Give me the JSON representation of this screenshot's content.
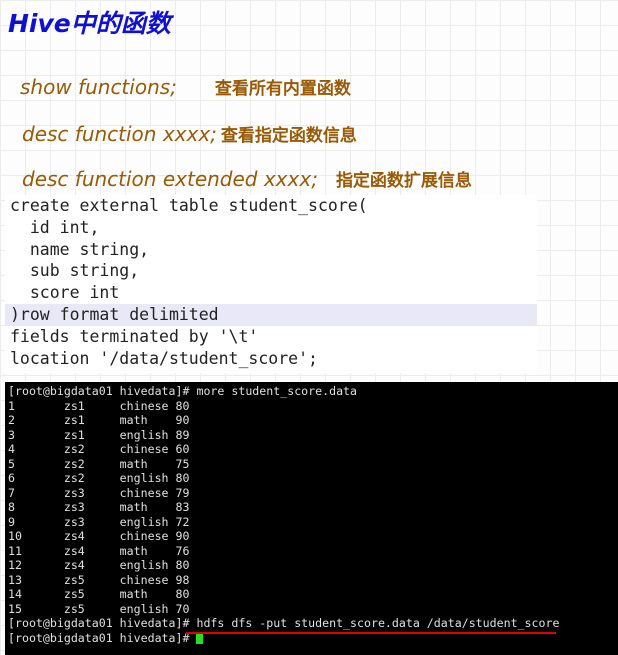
{
  "title": "Hive中的函数",
  "notes": [
    {
      "cmd": "show functions;",
      "desc": "查看所有内置函数"
    },
    {
      "cmd": "desc function xxxx;",
      "desc": "查看指定函数信息"
    },
    {
      "cmd": "desc function extended xxxx;",
      "desc": "指定函数扩展信息"
    }
  ],
  "code": [
    "create external table student_score(",
    "  id int,",
    "  name string,",
    "  sub string,",
    "  score int",
    ")row format delimited",
    "fields terminated by '\\t'",
    "location '/data/student_score';"
  ],
  "terminal": {
    "prompt": "[root@bigdata01 hivedata]# ",
    "cmd1": "more student_score.data",
    "rows": [
      [
        "1",
        "zs1",
        "chinese",
        "80"
      ],
      [
        "2",
        "zs1",
        "math",
        "90"
      ],
      [
        "3",
        "zs1",
        "english",
        "89"
      ],
      [
        "4",
        "zs2",
        "chinese",
        "60"
      ],
      [
        "5",
        "zs2",
        "math",
        "75"
      ],
      [
        "6",
        "zs2",
        "english",
        "80"
      ],
      [
        "7",
        "zs3",
        "chinese",
        "79"
      ],
      [
        "8",
        "zs3",
        "math",
        "83"
      ],
      [
        "9",
        "zs3",
        "english",
        "72"
      ],
      [
        "10",
        "zs4",
        "chinese",
        "90"
      ],
      [
        "11",
        "zs4",
        "math",
        "76"
      ],
      [
        "12",
        "zs4",
        "english",
        "80"
      ],
      [
        "13",
        "zs5",
        "chinese",
        "98"
      ],
      [
        "14",
        "zs5",
        "math",
        "80"
      ],
      [
        "15",
        "zs5",
        "english",
        "70"
      ]
    ],
    "cmd2": "hdfs dfs -put student_score.data /data/student_score",
    "cursor_color": "#22e022",
    "underline_color": "#e00000"
  }
}
